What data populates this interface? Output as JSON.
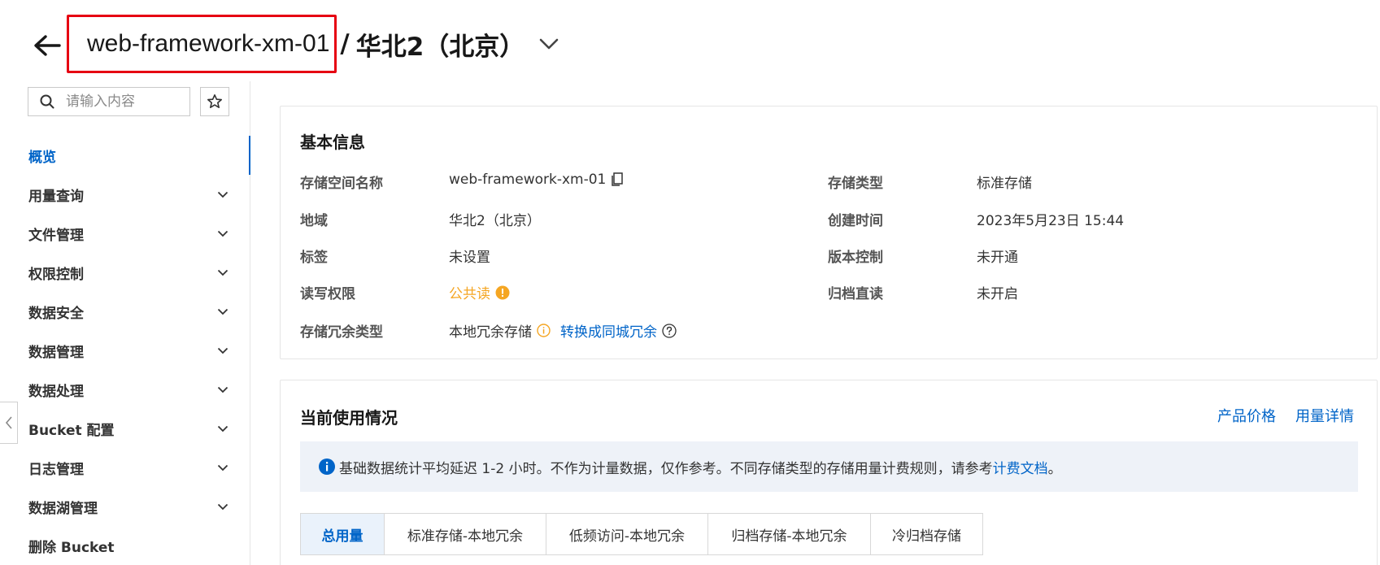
{
  "header": {
    "bucket_name": "web-framework-xm-01",
    "separator": "/",
    "region": "华北2（北京）"
  },
  "sidebar": {
    "search_placeholder": "请输入内容",
    "items": [
      {
        "label": "概览"
      },
      {
        "label": "用量查询"
      },
      {
        "label": "文件管理"
      },
      {
        "label": "权限控制"
      },
      {
        "label": "数据安全"
      },
      {
        "label": "数据管理"
      },
      {
        "label": "数据处理"
      },
      {
        "label": "Bucket 配置"
      },
      {
        "label": "日志管理"
      },
      {
        "label": "数据湖管理"
      },
      {
        "label": "删除 Bucket"
      }
    ]
  },
  "basic_info": {
    "title": "基本信息",
    "rows": {
      "bucket_name_label": "存储空间名称",
      "bucket_name_value": "web-framework-xm-01",
      "storage_type_label": "存储类型",
      "storage_type_value": "标准存储",
      "region_label": "地域",
      "region_value": "华北2（北京）",
      "created_label": "创建时间",
      "created_value": "2023年5月23日 15:44",
      "tags_label": "标签",
      "tags_value": "未设置",
      "versioning_label": "版本控制",
      "versioning_value": "未开通",
      "acl_label": "读写权限",
      "acl_value": "公共读",
      "archive_label": "归档直读",
      "archive_value": "未开启",
      "redundancy_label": "存储冗余类型",
      "redundancy_value": "本地冗余存储",
      "redundancy_link": "转换成同城冗余"
    }
  },
  "usage": {
    "title": "当前使用情况",
    "price_link": "产品价格",
    "detail_link": "用量详情",
    "notice_text": "基础数据统计平均延迟 1-2 小时。不作为计量数据，仅作参考。不同存储类型的存储用量计费规则，请参考",
    "notice_link": "计费文档",
    "notice_end": " 。",
    "tabs": [
      {
        "label": "总用量"
      },
      {
        "label": "标准存储-本地冗余"
      },
      {
        "label": "低频访问-本地冗余"
      },
      {
        "label": "归档存储-本地冗余"
      },
      {
        "label": "冷归档存储"
      }
    ]
  },
  "colors": {
    "accent": "#0064c8",
    "warning": "#f5a623",
    "highlight_border": "#e60012"
  }
}
